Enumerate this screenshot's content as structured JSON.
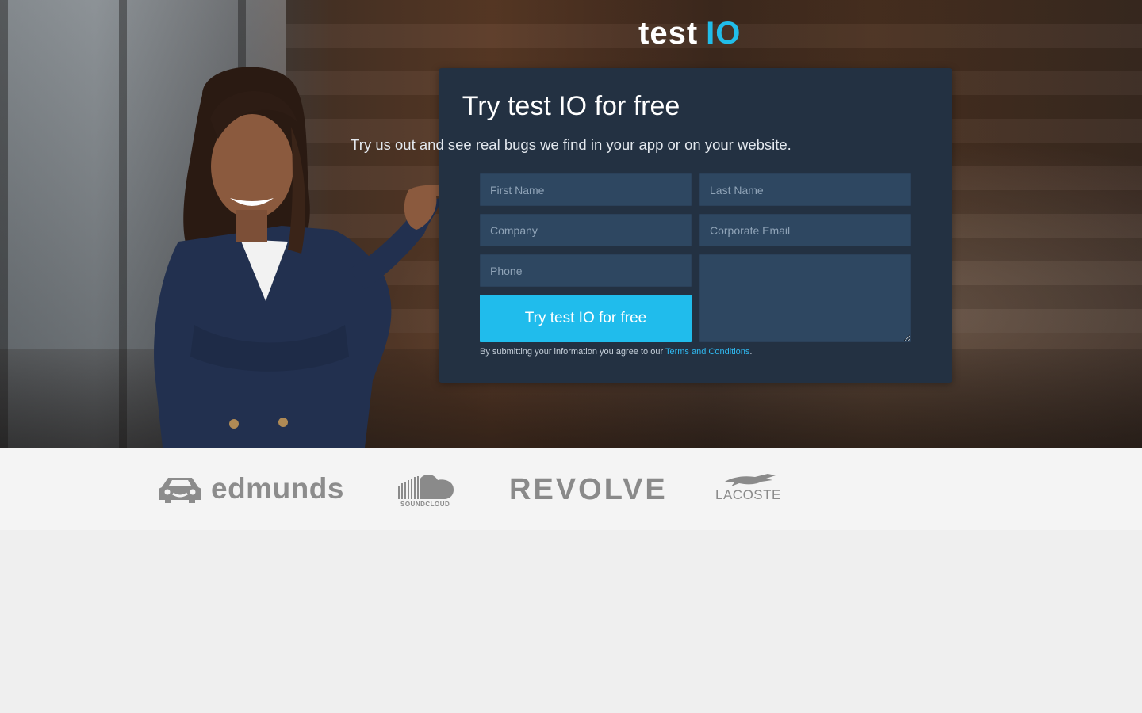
{
  "brand": {
    "logo_part1": "test",
    "logo_part2": "IO",
    "accent_color": "#21bde9"
  },
  "form": {
    "title": "Try test IO for free",
    "subtitle": "Try us out and see real bugs we find in your app or on your website.",
    "first_name_placeholder": "First Name",
    "last_name_placeholder": "Last Name",
    "company_placeholder": "Company",
    "email_placeholder": "Corporate Email",
    "phone_placeholder": "Phone",
    "message_placeholder": "",
    "submit_label": "Try test IO for free",
    "legal_prefix": "By submitting your information you agree to our ",
    "legal_link": "Terms and Conditions",
    "legal_suffix": "."
  },
  "clients": {
    "edmunds": "edmunds",
    "soundcloud": "SOUNDCLOUD",
    "revolve": "REVOLVE",
    "lacoste": "LACOSTE"
  }
}
